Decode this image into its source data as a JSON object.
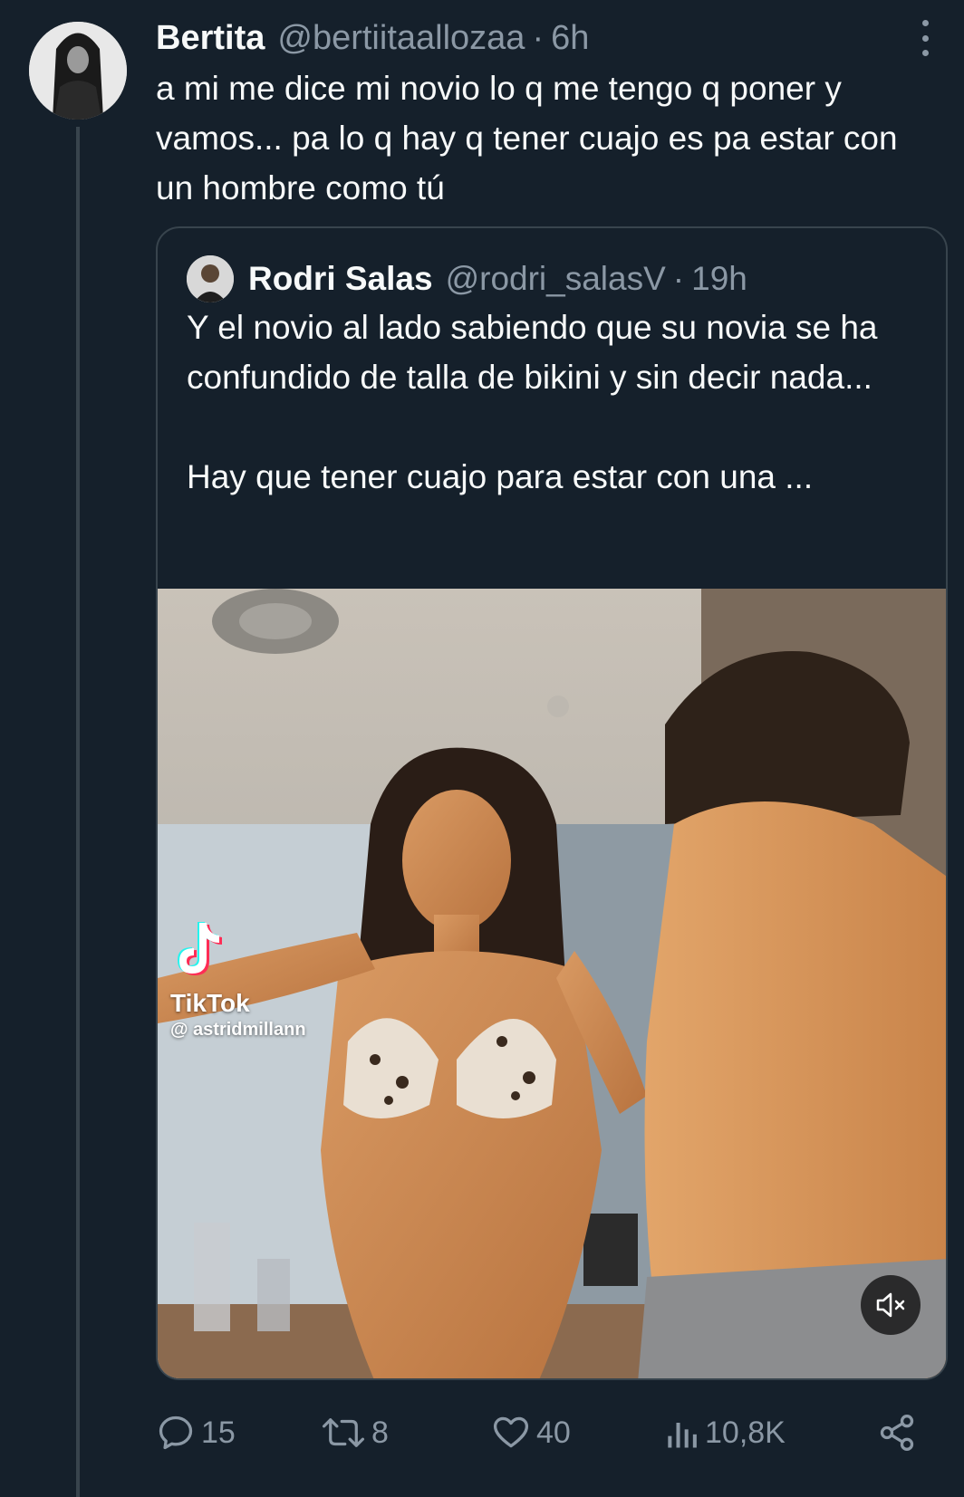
{
  "tweet": {
    "author": {
      "name": "Bertita",
      "handle": "@bertiitaallozaa",
      "separator": "·",
      "time": "6h"
    },
    "text": "a mi me dice mi novio lo q me tengo q poner y vamos... pa lo q hay q tener cuajo es pa estar con un hombre como tú",
    "more_icon": "more-vertical-icon"
  },
  "quoted": {
    "author": {
      "name": "Rodri Salas",
      "handle": "@rodri_salasV",
      "separator": "·",
      "time": "19h"
    },
    "paragraph1": "Y el novio al lado sabiendo que su novia se ha confundido de talla de bikini y sin decir nada...",
    "paragraph2": "Hay que tener cuajo para estar con una ...",
    "media": {
      "watermark_brand": "TikTok",
      "watermark_user": "@ astridmillann",
      "mute_icon": "volume-muted-icon"
    }
  },
  "actions": {
    "replies": "15",
    "retweets": "8",
    "likes": "40",
    "views": "10,8K",
    "share_icon": "share-icon"
  },
  "colors": {
    "background": "#15202b",
    "text": "#f7f9f9",
    "secondary": "#8b98a5",
    "border": "#38444d"
  }
}
